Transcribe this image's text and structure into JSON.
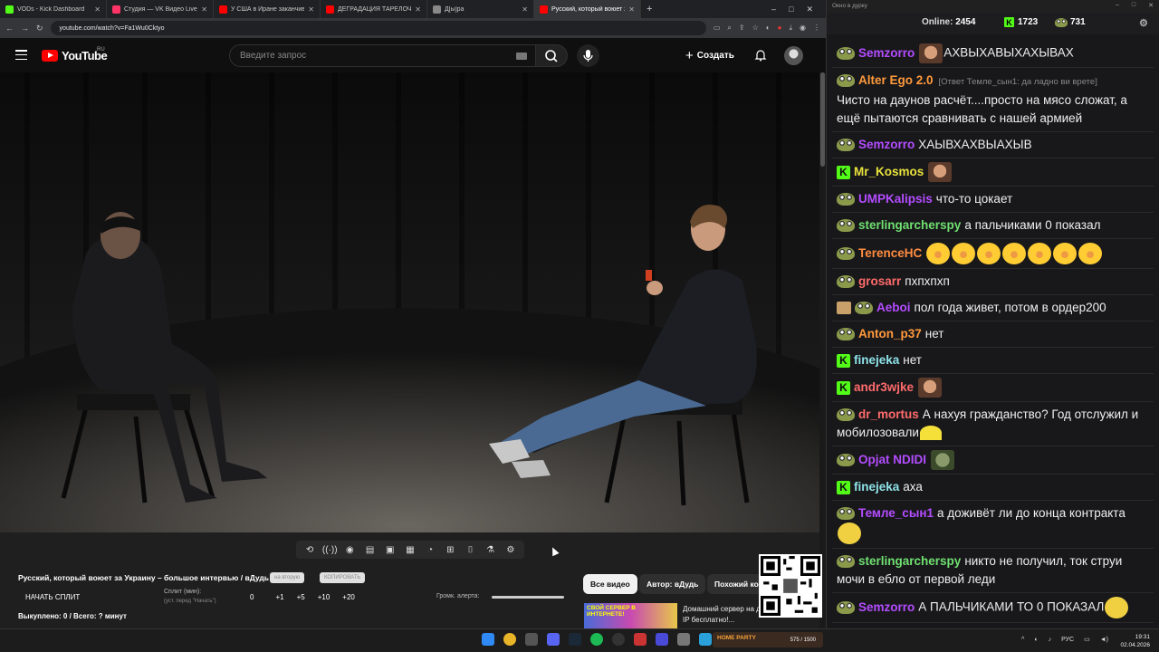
{
  "browser": {
    "tabs": [
      {
        "title": "VODs - Kick Dashboard",
        "color": "#53fc18",
        "active": false
      },
      {
        "title": "Студия — VK Видео Live",
        "color": "#ff3366",
        "active": false
      },
      {
        "title": "У США в Иране заканчиваются",
        "color": "#ff0000",
        "active": false
      },
      {
        "title": "ДЕГРАДАЦИЯ ТАРЕЛОЧНИЦ",
        "color": "#ff0000",
        "active": false
      },
      {
        "title": "Д[ы]ра",
        "color": "#888888",
        "active": false
      },
      {
        "title": "Русский, который воюет за Украину",
        "color": "#ff0000",
        "active": true
      }
    ],
    "url": "youtube.com/watch?v=Fa1Wu0Cktyo"
  },
  "youtube": {
    "logo_text": "YouTube",
    "region": "RU",
    "search_placeholder": "Введите запрос",
    "create_label": "Создать"
  },
  "below_video": {
    "title": "Русский, который воюет за Украину – большое интервью / вДудь",
    "pill1": "на вторую",
    "pill2": "КОПИРОВАТЬ",
    "split_start": "НАЧАТЬ СПЛИТ",
    "split_label": "Сплит (мин):",
    "split_hint": "(уст. перед \"Начать\")",
    "split_buttons": [
      "0",
      "+1",
      "+5",
      "+10",
      "+20"
    ],
    "alert_label": "Громк. алерта:",
    "bought": "Выкуплено: 0 / Всего: ? минут",
    "alert_volume": 1.0
  },
  "chips": {
    "all": "Все видео",
    "author": "Автор: вДудь",
    "similar": "Похожий ко"
  },
  "recommendation": {
    "thumb_text": "СВОЙ СЕРВЕР В ИНТЕРНЕТЕ!",
    "title": "Домашний сервер на динамическом IP бесплатно!..."
  },
  "chat": {
    "window_title": "Окно в дурку",
    "online_label": "Online:",
    "online_count": "2454",
    "kick_count": "1723",
    "frog_count": "731",
    "messages": [
      {
        "user": "Semzorro",
        "color": "#b44cff",
        "badge": "frog",
        "text": "АХВЫХАВЫХАХЫВАХ",
        "emote_before": "face"
      },
      {
        "user": "Alter Ego 2.0",
        "color": "#ff9a3c",
        "badge": "frog",
        "reply": "[Ответ Темле_сын1: да ладно ви врете]",
        "text": "Чисто на даунов расчёт....просто на мясо сложат, а ещё пытаются сравнивать с нашей армией"
      },
      {
        "user": "Semzorro",
        "color": "#b44cff",
        "badge": "frog",
        "text": "ХАЫВХАХВЫАХЫВ"
      },
      {
        "user": "Mr_Kosmos",
        "color": "#e8e23c",
        "badge": "kick",
        "text": "",
        "emote_after": "face"
      },
      {
        "user": "UMPKalipsis",
        "color": "#b44cff",
        "badge": "frog",
        "text": "что-то цокает"
      },
      {
        "user": "sterlingarcherspy",
        "color": "#6fe06f",
        "badge": "frog",
        "text": "а пальчиками 0 показал"
      },
      {
        "user": "TerenceHC",
        "color": "#ff8c40",
        "badge": "frog",
        "text": "",
        "laughs": 7
      },
      {
        "user": "grosarr",
        "color": "#ff6b6b",
        "badge": "frog",
        "text": "пхпхпхп"
      },
      {
        "user": "Aeboi",
        "color": "#b44cff",
        "badge": "giftfrog",
        "text": "пол года живет, потом в ордер200"
      },
      {
        "user": "Anton_p37",
        "color": "#ff9a3c",
        "badge": "frog",
        "text": "нет"
      },
      {
        "user": "finejeka",
        "color": "#8ee3e8",
        "badge": "kick",
        "text": "нет"
      },
      {
        "user": "andr3wjke",
        "color": "#ff6b6b",
        "badge": "kick",
        "text": "",
        "emote_after": "face"
      },
      {
        "user": "dr_mortus",
        "color": "#ff6b6b",
        "badge": "frog",
        "text": "А нахуя гражданство? Год отслужил и мобилозовали",
        "emote_after": "banana"
      },
      {
        "user": "Opjat NDIDI",
        "color": "#b44cff",
        "badge": "frog",
        "text": "",
        "emote_after": "ogre"
      },
      {
        "user": "finejeka",
        "color": "#8ee3e8",
        "badge": "kick",
        "text": "аха"
      },
      {
        "user": "Темле_сын1",
        "color": "#b44cff",
        "badge": "frog",
        "text": "а доживёт ли до конца контракта",
        "emote_after": "gold"
      },
      {
        "user": "sterlingarcherspy",
        "color": "#6fe06f",
        "badge": "frog",
        "text": "никто не получил, ток струи мочи в ебло от первой леди"
      },
      {
        "user": "Semzorro",
        "color": "#b44cff",
        "badge": "frog",
        "text": "А ПАЛЬЧИКАМИ ТО 0 ПОКАЗАЛ",
        "emote_after": "gold"
      }
    ]
  },
  "taskbar": {
    "stream_brand": "HOME PARTY",
    "stream_count": "575 / 1500",
    "lang": "РУС",
    "time": "19:31",
    "date": "02.04.2026"
  }
}
